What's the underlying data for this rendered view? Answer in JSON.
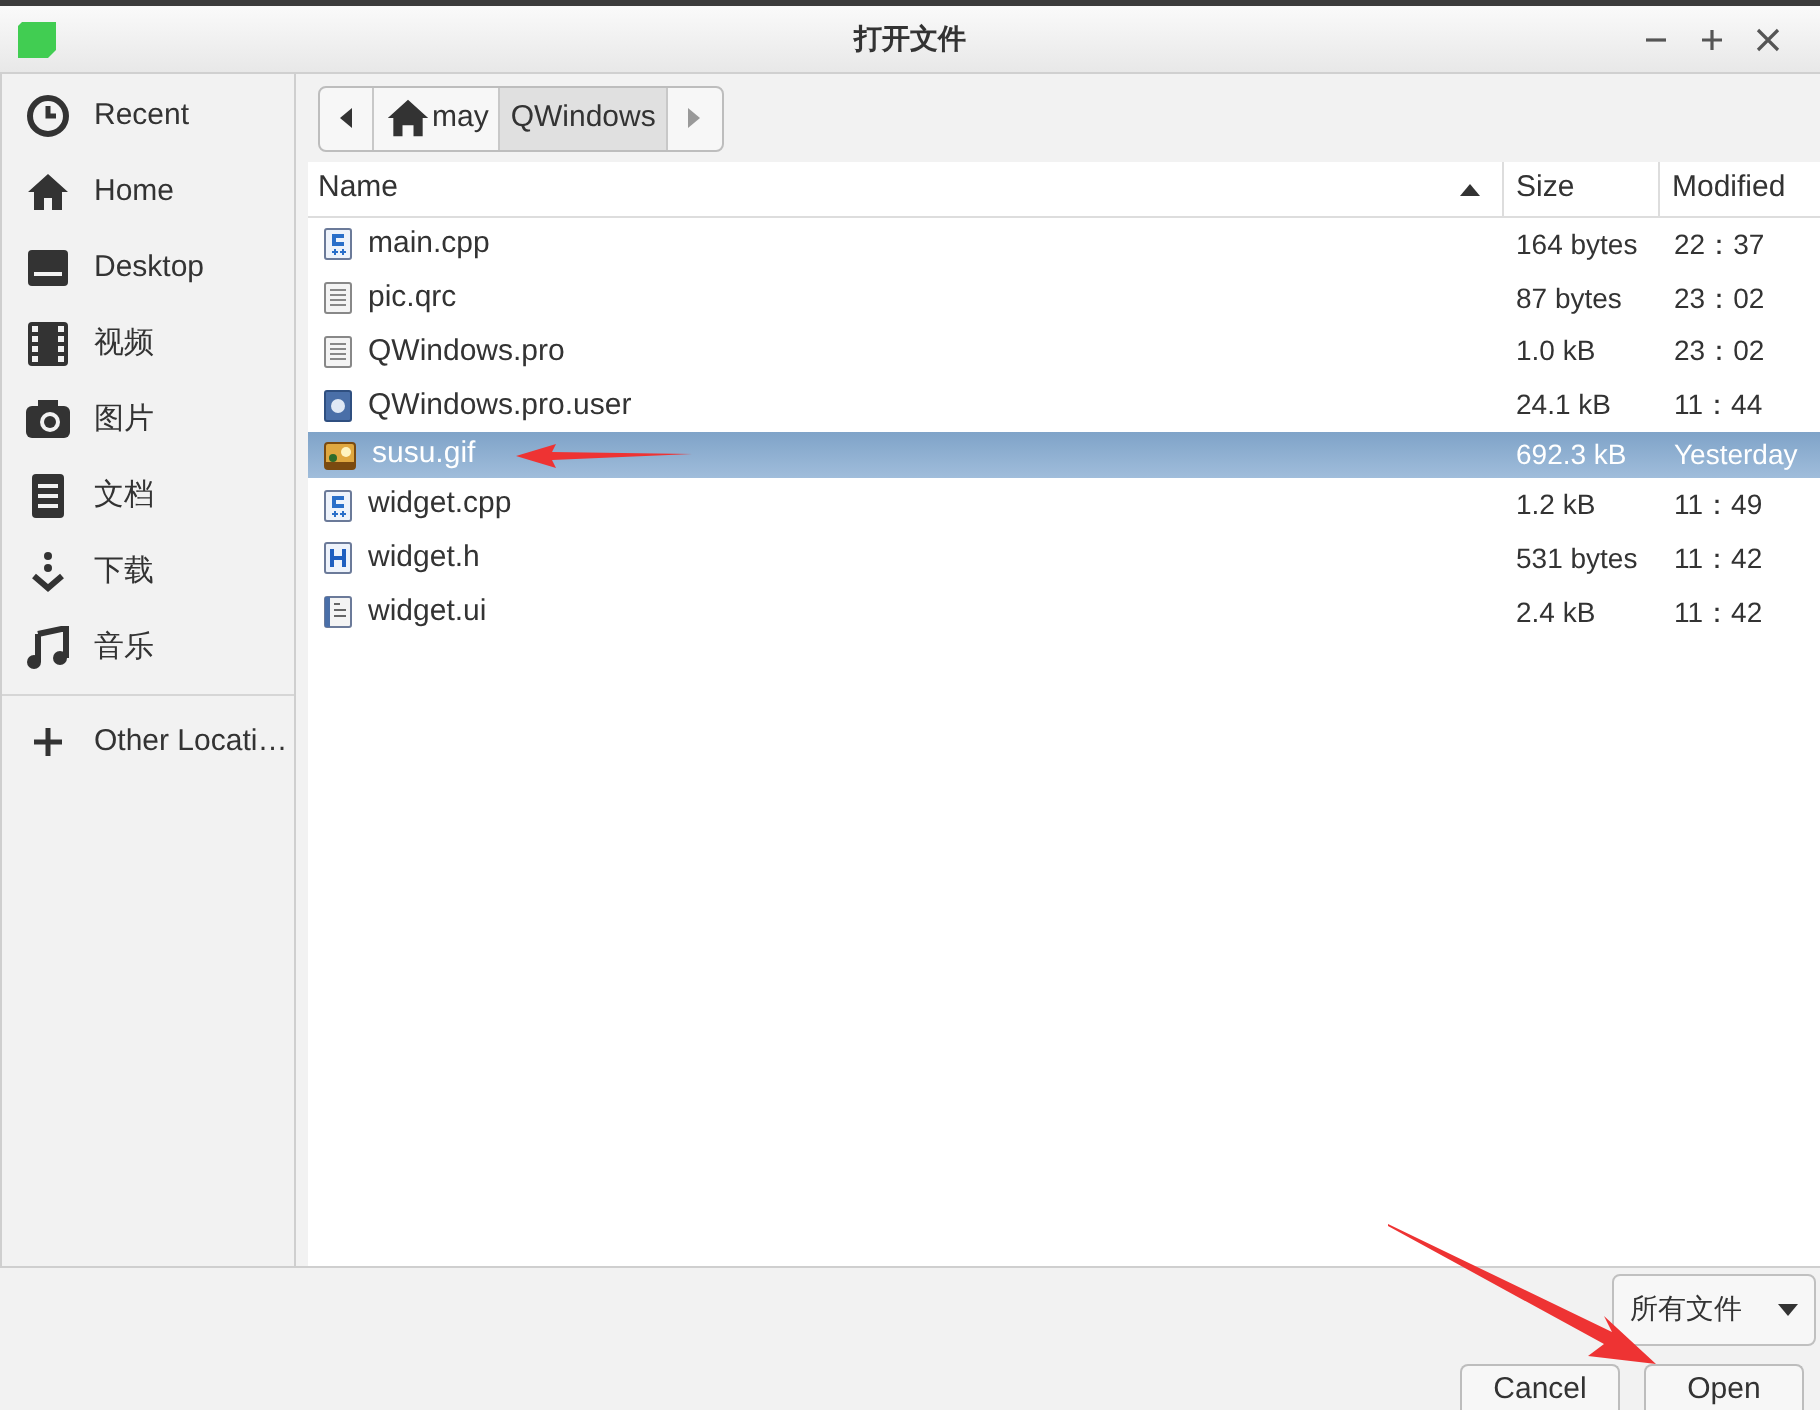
{
  "window": {
    "title": "打开文件"
  },
  "sidebar": {
    "items": [
      {
        "label": "Recent"
      },
      {
        "label": "Home"
      },
      {
        "label": "Desktop"
      },
      {
        "label": "视频"
      },
      {
        "label": "图片"
      },
      {
        "label": "文档"
      },
      {
        "label": "下载"
      },
      {
        "label": "音乐"
      }
    ],
    "other": {
      "label": "Other Locati…"
    }
  },
  "path_bar": {
    "segments": [
      {
        "label": "may",
        "kind": "home",
        "selected": false
      },
      {
        "label": "QWindows",
        "kind": "folder",
        "selected": true
      }
    ]
  },
  "table": {
    "columns": [
      "Name",
      "Size",
      "Modified"
    ],
    "rows": [
      {
        "name": "main.cpp",
        "kind": "cpp",
        "size": "164 bytes",
        "modified": "22：37",
        "selected": false
      },
      {
        "name": "pic.qrc",
        "kind": "text",
        "size": "87 bytes",
        "modified": "23：02",
        "selected": false
      },
      {
        "name": "QWindows.pro",
        "kind": "text",
        "size": "1.0 kB",
        "modified": "23：02",
        "selected": false
      },
      {
        "name": "QWindows.pro.user",
        "kind": "user",
        "size": "24.1 kB",
        "modified": "11：44",
        "selected": false
      },
      {
        "name": "susu.gif",
        "kind": "image",
        "size": "692.3 kB",
        "modified": "Yesterday",
        "selected": true
      },
      {
        "name": "widget.cpp",
        "kind": "cpp",
        "size": "1.2 kB",
        "modified": "11：49",
        "selected": false
      },
      {
        "name": "widget.h",
        "kind": "header",
        "size": "531 bytes",
        "modified": "11：42",
        "selected": false
      },
      {
        "name": "widget.ui",
        "kind": "ui",
        "size": "2.4 kB",
        "modified": "11：42",
        "selected": false
      }
    ]
  },
  "filter": {
    "value": "所有文件"
  },
  "buttons": [
    "Cancel",
    "Open"
  ]
}
